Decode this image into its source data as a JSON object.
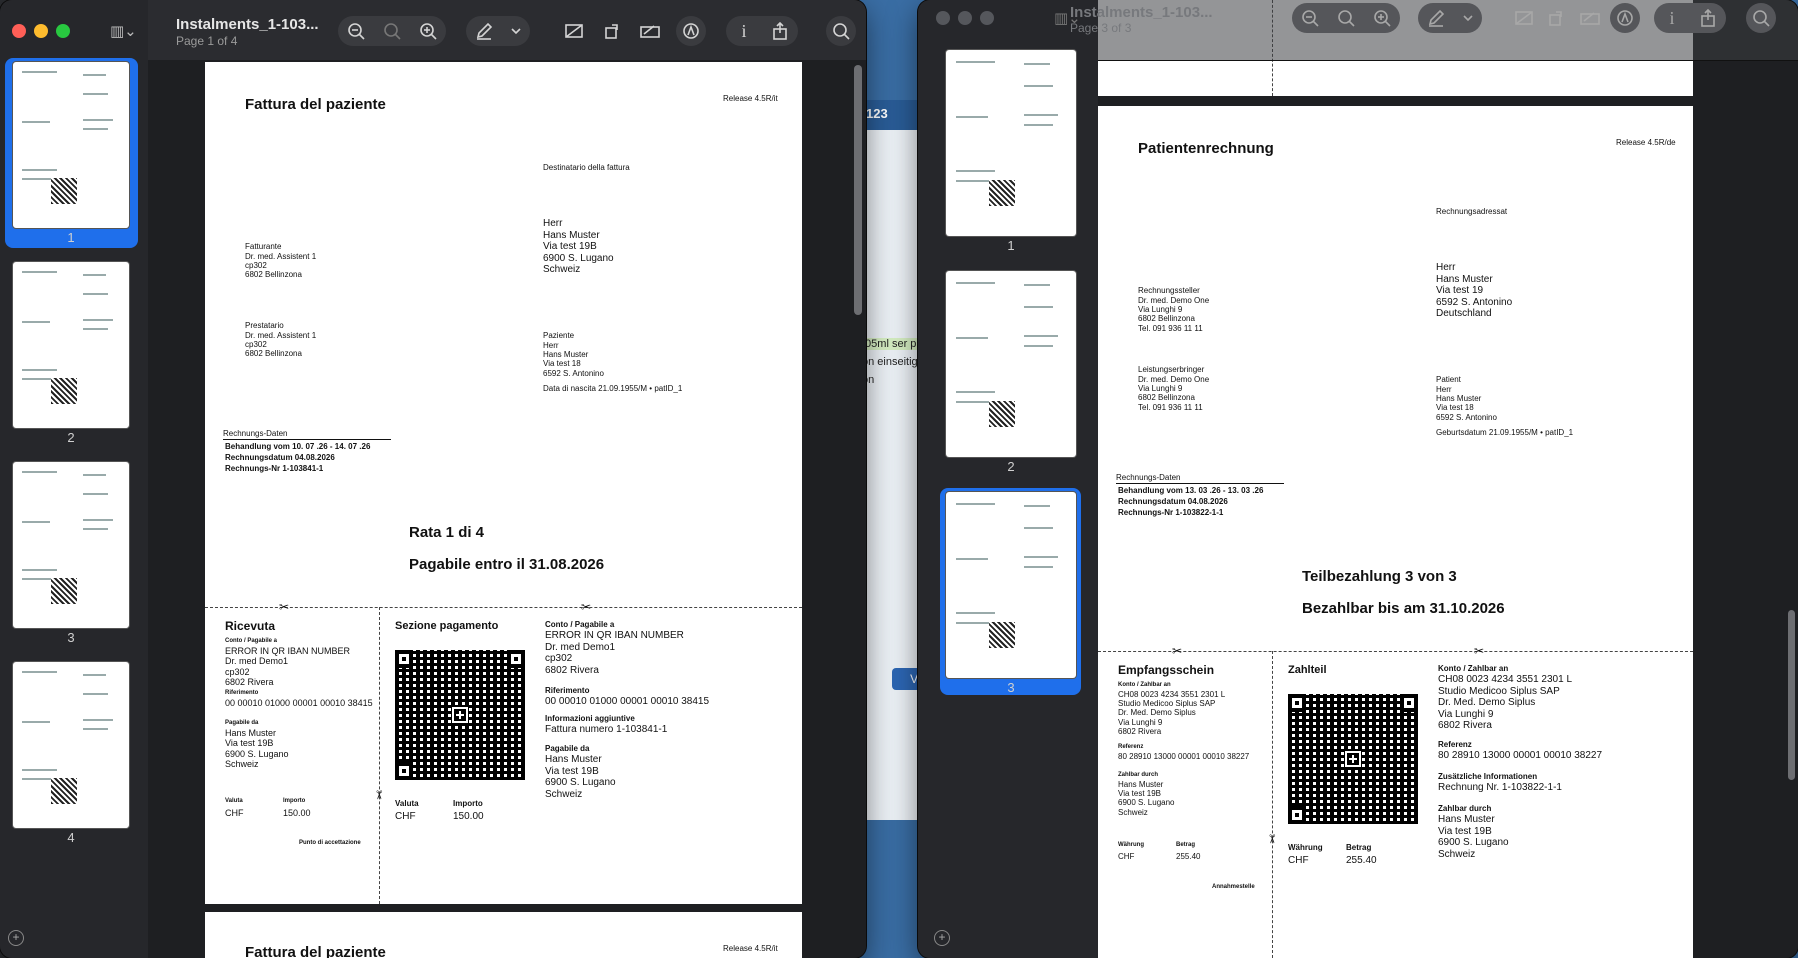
{
  "background_app": {
    "tab_text": "123",
    "row1": ".05ml ser p",
    "row2": "on einseitig",
    "row3": "on",
    "button_label": "Va"
  },
  "window1": {
    "title": "Instalments_1-103...",
    "subtitle": "Page 1 of 4",
    "thumbnails": [
      {
        "label": "1"
      },
      {
        "label": "2"
      },
      {
        "label": "3"
      },
      {
        "label": "4"
      }
    ],
    "page": {
      "heading": "Fattura del paziente",
      "release": "Release 4.5R/it",
      "recipient_label": "Destinatario della fattura",
      "recipient": [
        "Herr",
        "Hans Muster",
        "Via test 19B",
        "6900 S. Lugano",
        "Schweiz"
      ],
      "biller_label": "Fatturante",
      "biller": [
        "Dr. med.  Assistent 1",
        "cp302",
        "6802 Bellinzona"
      ],
      "provider_label": "Prestatario",
      "provider": [
        "Dr. med.  Assistent 1",
        "cp302",
        "6802 Bellinzona"
      ],
      "patient_label": "Paziente",
      "patient": [
        "Herr",
        "Hans Muster",
        "Via test 18",
        "6592 S. Antonino"
      ],
      "birthdate": "Data di nascita 21.09.1955/M • patID_1",
      "invoice_data_label": "Rechnungs-Daten",
      "invoice_data": [
        {
          "label": "Behandlung vom",
          "value": "10. 07 .26  -  14. 07 .26"
        },
        {
          "label": "Rechnungsdatum",
          "value": "04.08.2026"
        },
        {
          "label": "Rechnungs-Nr",
          "value": "1-103841-1"
        }
      ],
      "instalment": "Rata 1 di 4",
      "payable": "Pagabile entro il 31.08.2026",
      "receipt": {
        "title": "Ricevuta",
        "account_label": "Conto / Pagabile a",
        "account": [
          "ERROR IN QR IBAN NUMBER",
          "Dr. med Demo1",
          "cp302",
          "6802 Rivera"
        ],
        "reference_label": "Riferimento",
        "reference": "00 00010 01000 00001 00010 38415",
        "payer_label": "Pagabile da",
        "payer": [
          "Hans Muster",
          "Via test 19B",
          "6900 S. Lugano",
          "Schweiz"
        ],
        "currency_label": "Valuta",
        "amount_label": "Importo",
        "currency": "CHF",
        "amount": "150.00",
        "acceptance": "Punto di accettazione"
      },
      "payment": {
        "title": "Sezione pagamento",
        "account_label": "Conto / Pagabile a",
        "account": [
          "ERROR IN QR IBAN NUMBER",
          "Dr. med Demo1",
          "cp302",
          "6802 Rivera"
        ],
        "reference_label": "Riferimento",
        "reference": "00 00010 01000 00001 00010 38415",
        "info_label": "Informazioni aggiuntive",
        "info": "Fattura numero 1-103841-1",
        "payer_label": "Pagabile da",
        "payer": [
          "Hans Muster",
          "Via test 19B",
          "6900 S. Lugano",
          "Schweiz"
        ],
        "currency_label": "Valuta",
        "amount_label": "Importo",
        "currency": "CHF",
        "amount": "150.00"
      },
      "next_heading": "Fattura del paziente",
      "next_release": "Release 4.5R/it"
    }
  },
  "window2": {
    "title": "Instalments_1-103...",
    "subtitle": "Page 3 of 3",
    "thumbnails": [
      {
        "label": "1"
      },
      {
        "label": "2"
      },
      {
        "label": "3"
      }
    ],
    "page": {
      "heading": "Patientenrechnung",
      "release": "Release 4.5R/de",
      "recipient_label": "Rechnungsadressat",
      "recipient": [
        "Herr",
        "Hans Muster",
        "Via test 19",
        "6592 S. Antonino",
        "Deutschland"
      ],
      "biller_label": "Rechnungssteller",
      "biller": [
        "Dr. med. Demo One",
        "Via Lunghi 9",
        "6802 Bellinzona",
        "Tel. 091 936 11 11"
      ],
      "provider_label": "Leistungserbringer",
      "provider": [
        "Dr. med. Demo One",
        "Via Lunghi 9",
        "6802 Bellinzona",
        "Tel. 091 936 11 11"
      ],
      "patient_label": "Patient",
      "patient": [
        "Herr",
        "Hans Muster",
        "Via test 18",
        "6592 S. Antonino"
      ],
      "birthdate": "Geburtsdatum 21.09.1955/M • patID_1",
      "invoice_data_label": "Rechnungs-Daten",
      "invoice_data": [
        {
          "label": "Behandlung vom",
          "value": "13. 03 .26  -  13. 03 .26"
        },
        {
          "label": "Rechnungsdatum",
          "value": "04.08.2026"
        },
        {
          "label": "Rechnungs-Nr",
          "value": "1-103822-1-1"
        }
      ],
      "instalment": "Teilbezahlung 3 von 3",
      "payable": "Bezahlbar bis am 31.10.2026",
      "receipt": {
        "title": "Empfangsschein",
        "account_label": "Konto / Zahlbar an",
        "account": [
          "CH08 0023 4234 3551 2301 L",
          "Studio Medicoo Siplus SAP",
          "Dr. Med. Demo Siplus",
          "Via Lunghi 9",
          "6802 Rivera"
        ],
        "reference_label": "Referenz",
        "reference": "80 28910 13000 00001 00010 38227",
        "payer_label": "Zahlbar durch",
        "payer": [
          "Hans Muster",
          "Via test 19B",
          "6900 S. Lugano",
          "Schweiz"
        ],
        "currency_label": "Währung",
        "amount_label": "Betrag",
        "currency": "CHF",
        "amount": "255.40",
        "acceptance": "Annahmestelle"
      },
      "payment": {
        "title": "Zahlteil",
        "account_label": "Konto / Zahlbar an",
        "account": [
          "CH08 0023 4234 3551 2301 L",
          "Studio Medicoo Siplus SAP",
          "Dr. Med. Demo Siplus",
          "Via Lunghi 9",
          "6802 Rivera"
        ],
        "reference_label": "Referenz",
        "reference": "80 28910 13000 00001 00010 38227",
        "info_label": "Zusätzliche Informationen",
        "info": "Rechnung Nr. 1-103822-1-1",
        "payer_label": "Zahlbar durch",
        "payer": [
          "Hans Muster",
          "Via test 19B",
          "6900 S. Lugano",
          "Schweiz"
        ],
        "currency_label": "Währung",
        "amount_label": "Betrag",
        "currency": "CHF",
        "amount": "255.40"
      }
    }
  }
}
